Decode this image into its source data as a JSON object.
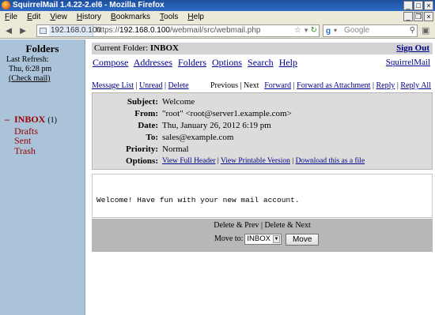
{
  "window": {
    "title": "SquirrelMail 1.4.22-2.el6 - Mozilla Firefox"
  },
  "menu": [
    "File",
    "Edit",
    "View",
    "History",
    "Bookmarks",
    "Tools",
    "Help"
  ],
  "nav": {
    "host": "192.168.0.100",
    "url_prefix": "https://",
    "url_host": "192.168.0.100",
    "url_path": "/webmail/src/webmail.php",
    "search_placeholder": "Google"
  },
  "sidebar": {
    "title": "Folders",
    "last_refresh_label": "Last Refresh:",
    "last_refresh_time": "Thu, 6:28 pm",
    "check_mail": "(Check mail)",
    "folders": [
      {
        "name": "INBOX",
        "count": "(1)",
        "current": true
      },
      {
        "name": "Drafts"
      },
      {
        "name": "Sent"
      },
      {
        "name": "Trash"
      }
    ]
  },
  "main": {
    "current_folder_label": "Current Folder:",
    "current_folder": "INBOX",
    "sign_out": "Sign Out",
    "brand": "SquirrelMail",
    "toplinks": [
      "Compose",
      "Addresses",
      "Folders",
      "Options",
      "Search",
      "Help"
    ],
    "msgnav": {
      "message_list": "Message List",
      "unread": "Unread",
      "delete": "Delete",
      "previous": "Previous",
      "next": "Next",
      "forward": "Forward",
      "forward_attachment": "Forward as Attachment",
      "reply": "Reply",
      "reply_all": "Reply All"
    },
    "headers": {
      "subject_label": "Subject:",
      "subject": "Welcome",
      "from_label": "From:",
      "from": "\"root\" <root@server1.example.com>",
      "date_label": "Date:",
      "date": "Thu, January 26, 2012 6:19 pm",
      "to_label": "To:",
      "to": "sales@example.com",
      "priority_label": "Priority:",
      "priority": "Normal",
      "options_label": "Options:",
      "view_full_header": "View Full Header",
      "view_printable": "View Printable Version",
      "download": "Download this as a file"
    },
    "body": "Welcome! Have fun with your new mail account.",
    "footer": {
      "delete_prev": "Delete & Prev",
      "delete_next": "Delete & Next",
      "move_to_label": "Move to:",
      "move_to_value": "INBOX",
      "move_button": "Move"
    }
  }
}
